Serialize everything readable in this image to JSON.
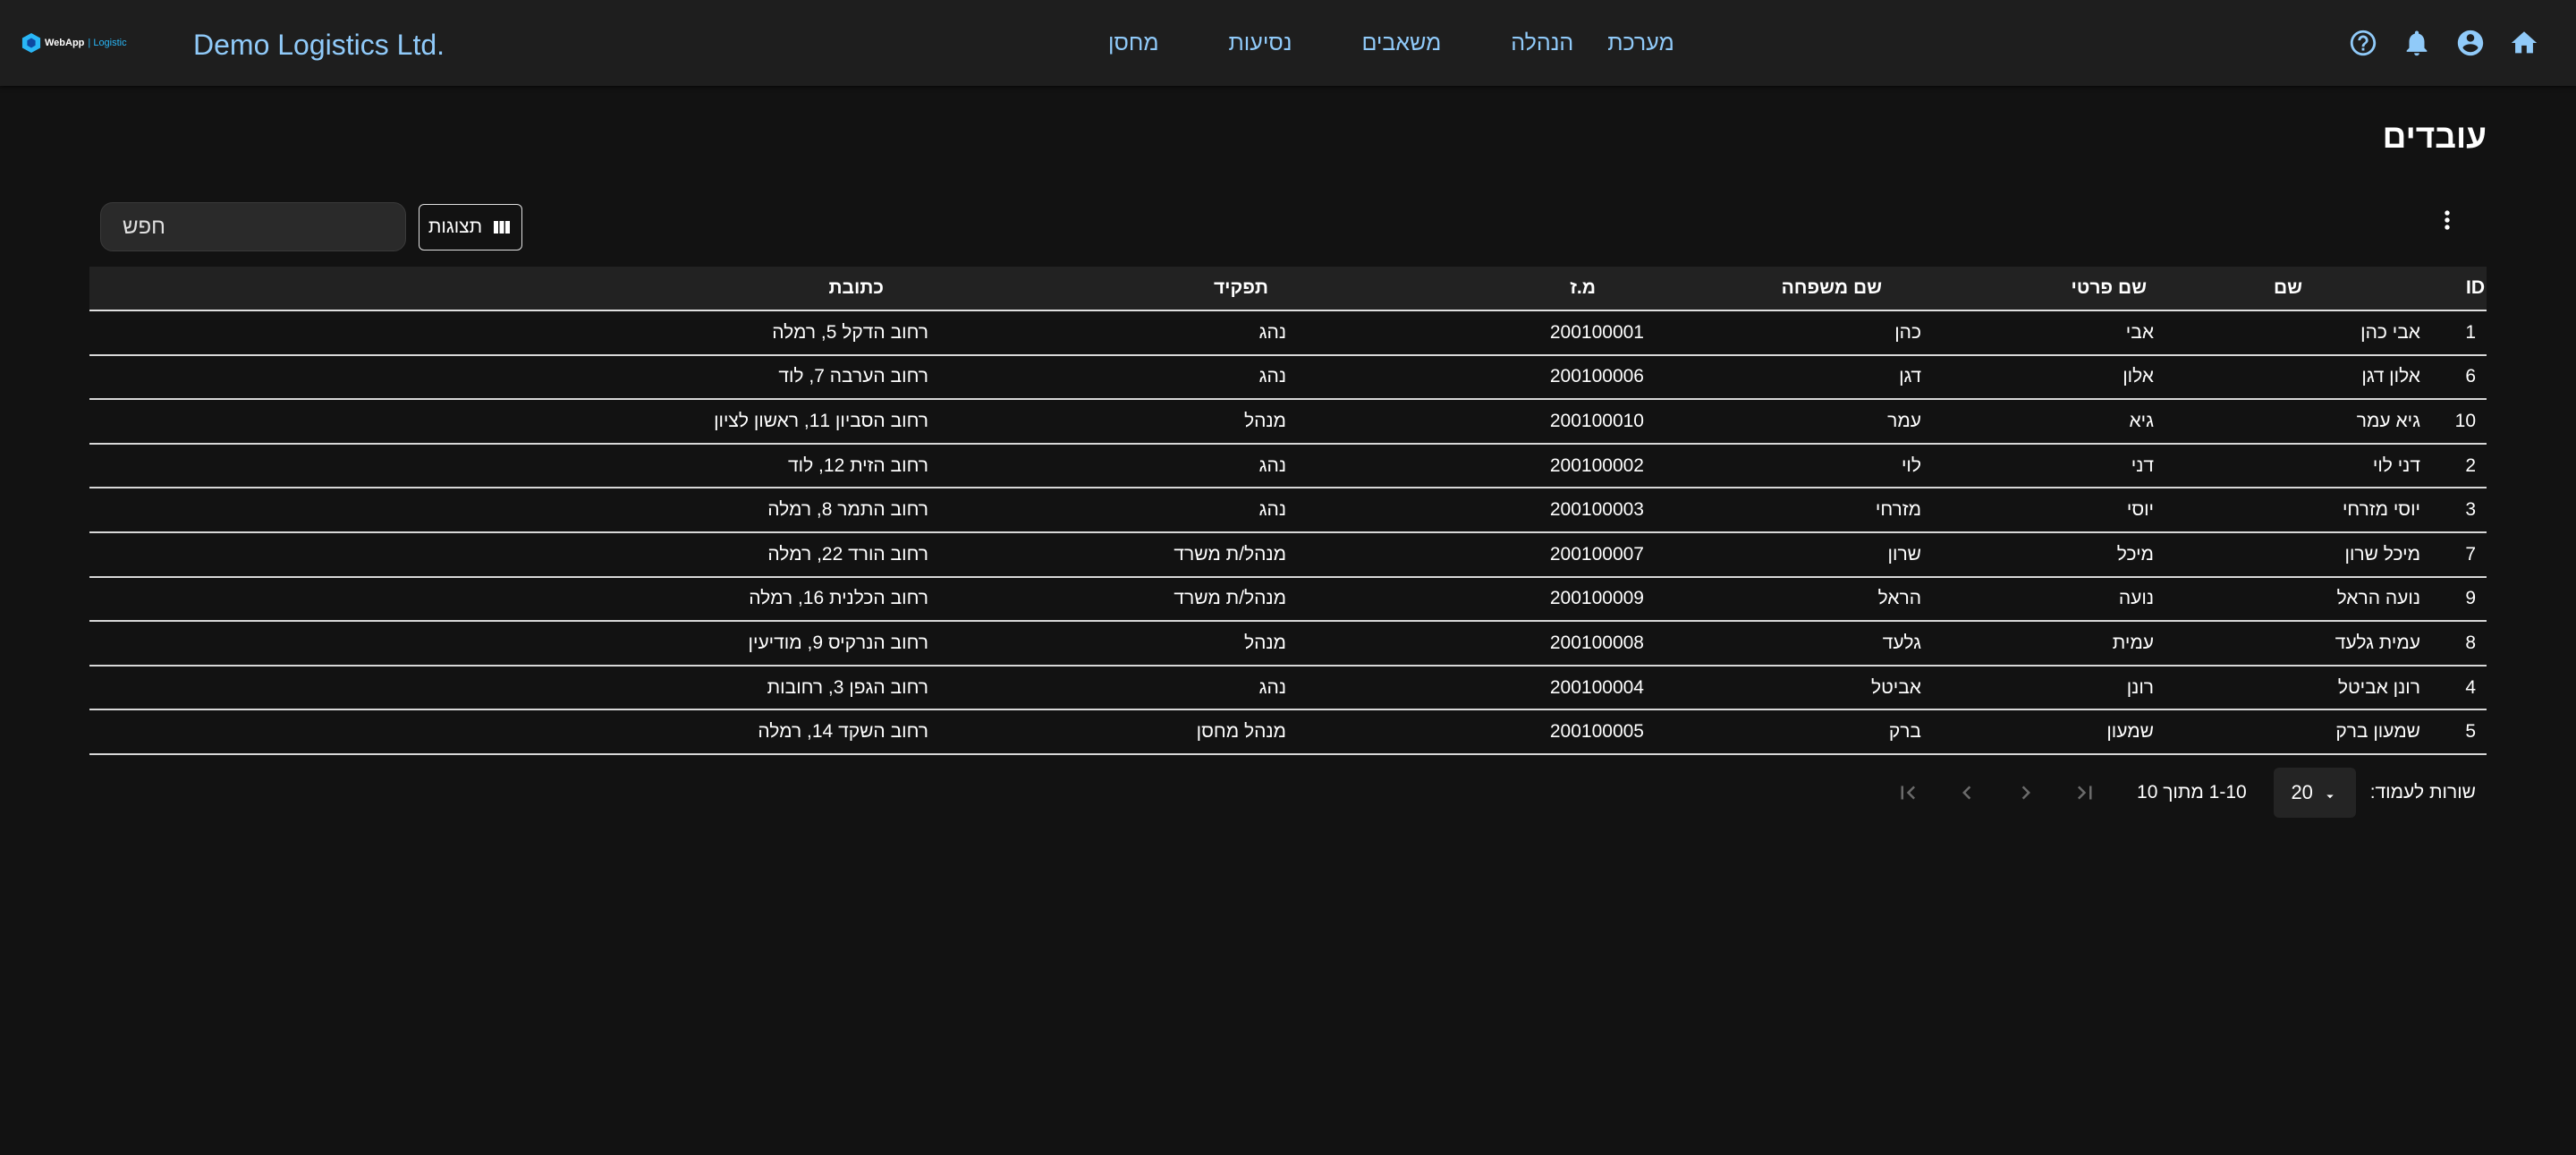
{
  "header": {
    "logo": {
      "name": "WebApp",
      "sub": "| Logistic"
    },
    "company": "Demo Logistics Ltd.",
    "nav": [
      "מחסן",
      "נסיעות",
      "משאבים",
      "הנהלה",
      "מערכת"
    ],
    "icons": [
      "home-icon",
      "account-icon",
      "bell-icon",
      "help-icon"
    ]
  },
  "page": {
    "title": "עובדים",
    "columns_button": "תצוגות",
    "search_placeholder": "חפש"
  },
  "table": {
    "headers": [
      "ID",
      "שם",
      "שם פרטי",
      "שם משפחה",
      "מ.ז",
      "תפקיד",
      "כתובת"
    ],
    "rows": [
      [
        "1",
        "אבי כהן",
        "אבי",
        "כהן",
        "200100001",
        "נהג",
        "רחוב הדקל 5, רמלה"
      ],
      [
        "6",
        "אלון דגן",
        "אלון",
        "דגן",
        "200100006",
        "נהג",
        "רחוב הערבה 7, לוד"
      ],
      [
        "10",
        "גיא עמר",
        "גיא",
        "עמר",
        "200100010",
        "מנהל",
        "רחוב הסביון 11, ראשון לציון"
      ],
      [
        "2",
        "דני לוי",
        "דני",
        "לוי",
        "200100002",
        "נהג",
        "רחוב הזית 12, לוד"
      ],
      [
        "3",
        "יוסי מזרחי",
        "יוסי",
        "מזרחי",
        "200100003",
        "נהג",
        "רחוב התמר 8, רמלה"
      ],
      [
        "7",
        "מיכל שרון",
        "מיכל",
        "שרון",
        "200100007",
        "מנהל/ת משרד",
        "רחוב הורד 22, רמלה"
      ],
      [
        "9",
        "נועה הראל",
        "נועה",
        "הראל",
        "200100009",
        "מנהל/ת משרד",
        "רחוב הכלנית 16, רמלה"
      ],
      [
        "8",
        "עמית גלעד",
        "עמית",
        "גלעד",
        "200100008",
        "מנהל",
        "רחוב הנרקיס 9, מודיעין"
      ],
      [
        "4",
        "רונן אביטל",
        "רונן",
        "אביטל",
        "200100004",
        "נהג",
        "רחוב הגפן 3, רחובות"
      ],
      [
        "5",
        "שמעון ברק",
        "שמעון",
        "ברק",
        "200100005",
        "מנהל מחסן",
        "רחוב השקד 14, רמלה"
      ]
    ]
  },
  "pagination": {
    "rows_label": "שורות לעמוד:",
    "rows_per_page": "20",
    "range": "1-10 מתוך 10"
  },
  "colors": {
    "background": "#121212",
    "appbar": "#1e1e1e",
    "accent": "#90caf9"
  }
}
